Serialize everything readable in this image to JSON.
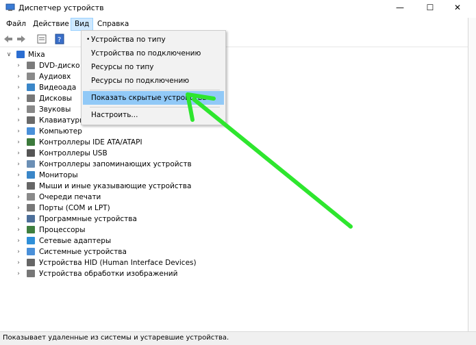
{
  "window": {
    "title": "Диспетчер устройств"
  },
  "window_controls": {
    "minimize": "—",
    "maximize": "☐",
    "close": "✕"
  },
  "menubar": [
    "Файл",
    "Действие",
    "Вид",
    "Справка"
  ],
  "tree": {
    "root": "Mixa",
    "items": [
      "DVD-диско",
      "Аудиовх",
      "Видеоада",
      "Дисковы",
      "Звуковы",
      "Клавиатуры",
      "Компьютер",
      "Контроллеры IDE ATA/ATAPI",
      "Контроллеры USB",
      "Контроллеры запоминающих устройств",
      "Мониторы",
      "Мыши и иные указывающие устройства",
      "Очереди печати",
      "Порты (COM и LPT)",
      "Программные устройства",
      "Процессоры",
      "Сетевые адаптеры",
      "Системные устройства",
      "Устройства HID (Human Interface Devices)",
      "Устройства обработки изображений"
    ]
  },
  "dropdown": {
    "bullet": "•",
    "items": [
      "Устройства по типу",
      "Устройства по подключению",
      "Ресурсы по типу",
      "Ресурсы по подключению",
      "Показать скрытые устройства",
      "Настроить..."
    ],
    "selected_index": 0,
    "highlighted_index": 4
  },
  "status": "Показывает удаленные из системы и устаревшие устройства.",
  "colors": {
    "arrow": "#2ee62e",
    "highlight": "#91c9f7",
    "menu_active": "#cde8ff"
  }
}
